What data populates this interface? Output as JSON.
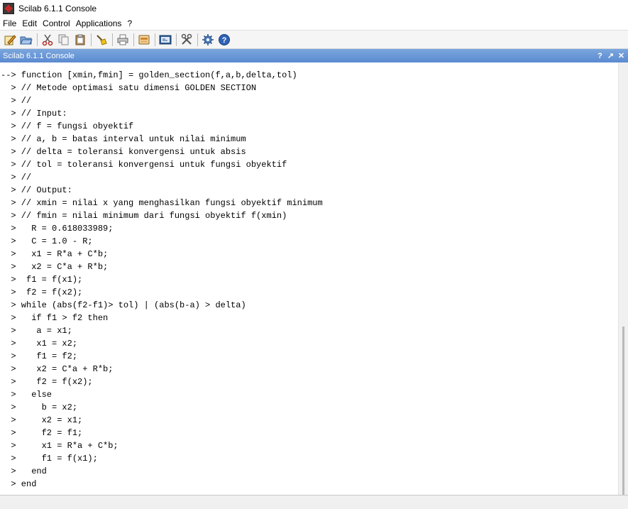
{
  "window": {
    "title": "Scilab 6.1.1 Console"
  },
  "menu": [
    "File",
    "Edit",
    "Control",
    "Applications",
    "?"
  ],
  "toolbar": {
    "icons": [
      "new-script-icon",
      "open-file-icon",
      "cut-icon",
      "copy-icon",
      "paste-icon",
      "clear-console-icon",
      "print-icon",
      "variable-browser-icon",
      "scinotes-icon",
      "module-manager-icon",
      "demos-icon",
      "help-icon"
    ]
  },
  "console": {
    "title": "Scilab 6.1.1 Console",
    "header_buttons": [
      "?",
      "↗",
      "✕"
    ],
    "lines": [
      "--> function [xmin,fmin] = golden_section(f,a,b,delta,tol)",
      "  > // Metode optimasi satu dimensi GOLDEN SECTION",
      "  > //",
      "  > // Input:",
      "  > // f = fungsi obyektif",
      "  > // a, b = batas interval untuk nilai minimum",
      "  > // delta = toleransi konvergensi untuk absis",
      "  > // tol = toleransi konvergensi untuk fungsi obyektif",
      "  > //",
      "  > // Output:",
      "  > // xmin = nilai x yang menghasilkan fungsi obyektif minimum",
      "  > // fmin = nilai minimum dari fungsi obyektif f(xmin)",
      "  >   R = 0.618033989;",
      "  >   C = 1.0 - R;",
      "  >   x1 = R*a + C*b;",
      "  >   x2 = C*a + R*b;",
      "  >  f1 = f(x1);",
      "  >  f2 = f(x2);",
      "  > while (abs(f2-f1)> tol) | (abs(b-a) > delta)",
      "  >   if f1 > f2 then",
      "  >    a = x1;",
      "  >    x1 = x2;",
      "  >    f1 = f2;",
      "  >    x2 = C*a + R*b;",
      "  >    f2 = f(x2);",
      "  >   else",
      "  >     b = x2;",
      "  >     x2 = x1;",
      "  >     f2 = f1;",
      "  >     x1 = R*a + C*b;",
      "  >     f1 = f(x1);",
      "  >   end",
      "  > end"
    ]
  },
  "colors": {
    "console_header": "#5a8ad0",
    "toolbar_bg": "#f5f5f5"
  }
}
